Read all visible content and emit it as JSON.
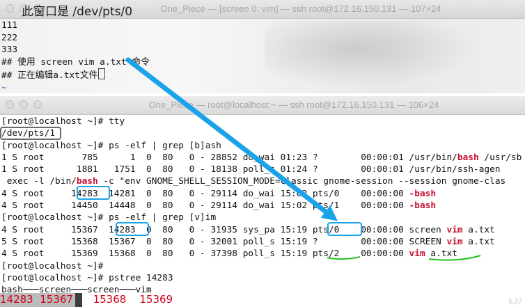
{
  "top_window": {
    "annotation": "此窗口是 /dev/pts/0",
    "title": "One_Piece — [screen 0: vim] — ssh root@172.16.150.131 — 107×24",
    "lines": [
      "111",
      "222",
      "333",
      "## 使用 screen vim a.txt 命令",
      "## 正在编辑a.txt文件"
    ],
    "tilde": "~"
  },
  "bottom_window": {
    "title": "One_Piece — root@localhost:~ — ssh root@172.16.150.131 — 106×24",
    "lines": [
      {
        "text": "[root@localhost ~]# tty"
      },
      {
        "text": "/dev/pts/1"
      },
      {
        "text": "[root@localhost ~]# ps -elf | grep [b]ash"
      },
      {
        "pre": "1 S root       785      1  0  80   0 - 28852 do_wai 01:23 ?        00:00:01 /usr/bin/",
        "hi": "bash",
        "post": " /usr/sb"
      },
      {
        "text": "1 S root      1881   1751  0  80   0 - 18138 poll_s 01:24 ?        00:00:01 /usr/bin/ssh-agen"
      },
      {
        "pre": " exec -l /bin/",
        "hi": "bash",
        "post": " -c \"env GNOME_SHELL_SESSION_MODE=classic gnome-session --session gnome-clas"
      },
      {
        "pre": "4 S root     14283  14281  0  80   0 - 29114 do_wai 15:02 pts/0    00:00:00 ",
        "hi": "-bash",
        "post": ""
      },
      {
        "pre": "4 S root     14450  14448  0  80   0 - 29114 do_wai 15:02 pts/1    00:00:00 ",
        "hi": "-bash",
        "post": ""
      },
      {
        "text": "[root@localhost ~]# ps -elf | grep [v]im"
      },
      {
        "pre": "4 S root     15367  14283  0  80   0 - 31935 sys_pa 15:19 pts/0    00:00:00 screen ",
        "hi": "vim",
        "post": " a.txt"
      },
      {
        "pre": "5 S root     15368  15367  0  80   0 - 32001 poll_s 15:19 ?        00:00:00 SCREEN ",
        "hi": "vim",
        "post": " a.txt"
      },
      {
        "pre": "4 S root     15369  15368  0  80   0 - 37398 poll_s 15:19 pts/2    00:00:00 ",
        "hi": "vim",
        "post": " a.txt"
      },
      {
        "text": "[root@localhost ~]#"
      },
      {
        "text": "[root@localhost ~]# pstree 14283"
      },
      {
        "text": "bash───screen───screen───vim"
      }
    ],
    "pid_labels": "14283  15367      15368    15369",
    "corner_text": "5,27"
  },
  "colors": {
    "arrow": "#1aa3e8",
    "highlight_blue": "#1aa3e8",
    "highlight_gray": "#6b6b6b",
    "underline_green": "#22c322",
    "red_text": "#d0021b"
  }
}
